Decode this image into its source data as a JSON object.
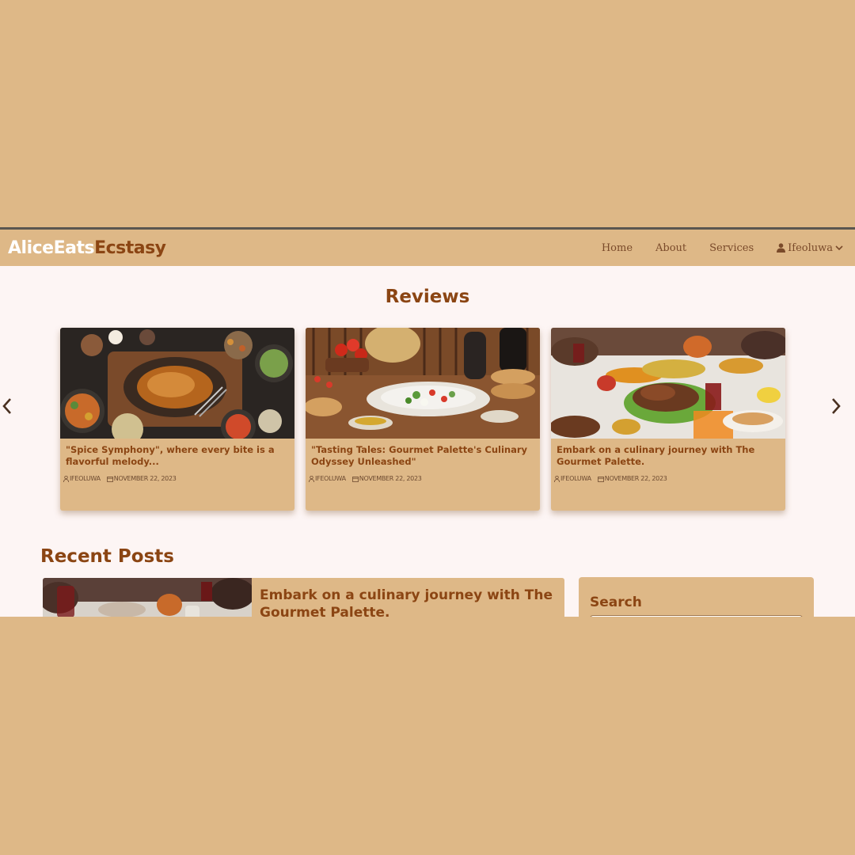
{
  "navbar": {
    "brand_part1": "AliceEats",
    "brand_part2": "Ecstasy",
    "links": [
      "Home",
      "About",
      "Services"
    ],
    "user": "Ifeoluwa"
  },
  "reviews": {
    "title": "Reviews",
    "cards": [
      {
        "title": "\"Spice Symphony\", where every bite is a flavorful melody...",
        "author": "IFEOLUWA",
        "date": "NOVEMBER 22, 2023"
      },
      {
        "title": "\"Tasting Tales: Gourmet Palette's Culinary Odyssey Unleashed\"",
        "author": "IFEOLUWA",
        "date": "NOVEMBER 22, 2023"
      },
      {
        "title": "Embark on a culinary journey with The Gourmet Palette.",
        "author": "IFEOLUWA",
        "date": "NOVEMBER 22, 2023"
      }
    ]
  },
  "recent": {
    "title": "Recent Posts",
    "post_title": "Embark on a culinary journey with The Gourmet Palette."
  },
  "sidebar": {
    "search_label": "Search",
    "search_placeholder": ""
  },
  "colors": {
    "page_bg": "#deb887",
    "content_bg": "#fdf5f4",
    "accent": "#8b4513",
    "brand_white": "#ffffff"
  },
  "icons": [
    "user-icon",
    "chevron-down-icon",
    "chevron-left-icon",
    "chevron-right-icon",
    "calendar-icon"
  ]
}
